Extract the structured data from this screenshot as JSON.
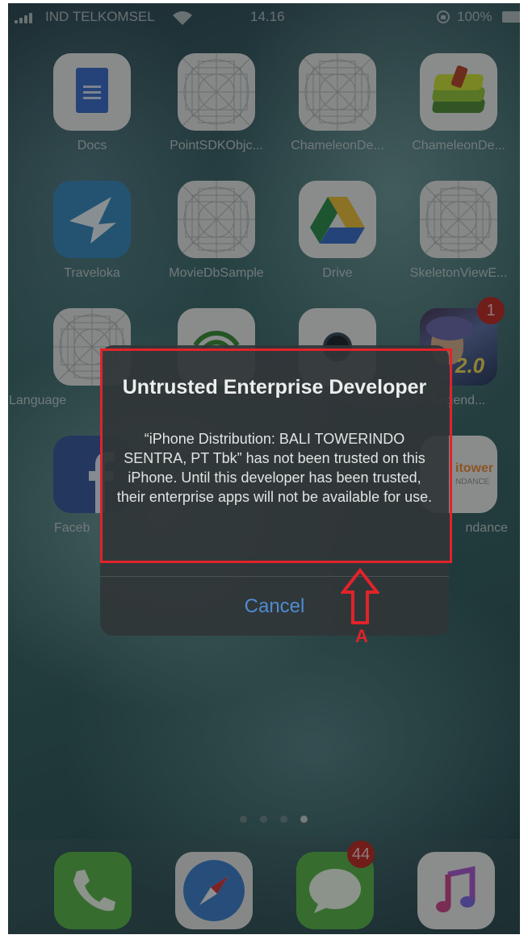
{
  "status_bar": {
    "carrier": "IND TELKOMSEL",
    "time": "14.16",
    "battery": "100%"
  },
  "apps": [
    {
      "label": "Docs",
      "icon": "docs-icon"
    },
    {
      "label": "PointSDKObjc...",
      "icon": "blank-app-icon"
    },
    {
      "label": "ChameleonDe...",
      "icon": "blank-app-icon"
    },
    {
      "label": "ChameleonDe...",
      "icon": "chameleon-icon"
    },
    {
      "label": "Traveloka",
      "icon": "traveloka-bird-icon"
    },
    {
      "label": "MovieDbSample",
      "icon": "blank-app-icon"
    },
    {
      "label": "Drive",
      "icon": "drive-icon"
    },
    {
      "label": "SkeletonViewE...",
      "icon": "blank-app-icon"
    },
    {
      "label": "Language",
      "icon": "blank-app-icon"
    },
    {
      "label": "",
      "icon": "radar-icon"
    },
    {
      "label": "",
      "icon": "camera-app-icon"
    },
    {
      "label": "Legend...",
      "icon": "game-icon",
      "badge": "1"
    },
    {
      "label": "Faceb",
      "icon": "facebook-icon"
    },
    {
      "label": "ndance",
      "icon": "attendance-icon"
    }
  ],
  "game_tile_text": "2.0",
  "attendance_tile_text": {
    "brand": "itower",
    "sub": "NDANCE"
  },
  "dock": [
    {
      "icon": "phone-icon"
    },
    {
      "icon": "safari-icon"
    },
    {
      "icon": "messages-icon",
      "badge": "44"
    },
    {
      "icon": "music-icon"
    }
  ],
  "alert": {
    "title": "Untrusted Enterprise Developer",
    "message": "“iPhone Distribution: BALI TOWERINDO SENTRA, PT Tbk” has not been trusted on this iPhone. Until this developer has been trusted, their enterprise apps will not be available for use.",
    "cancel_label": "Cancel"
  },
  "annotation": {
    "label": "A",
    "color": "#e1232a"
  },
  "colors": {
    "accent_blue": "#4f8bd2",
    "badge_red": "#b6302b"
  }
}
